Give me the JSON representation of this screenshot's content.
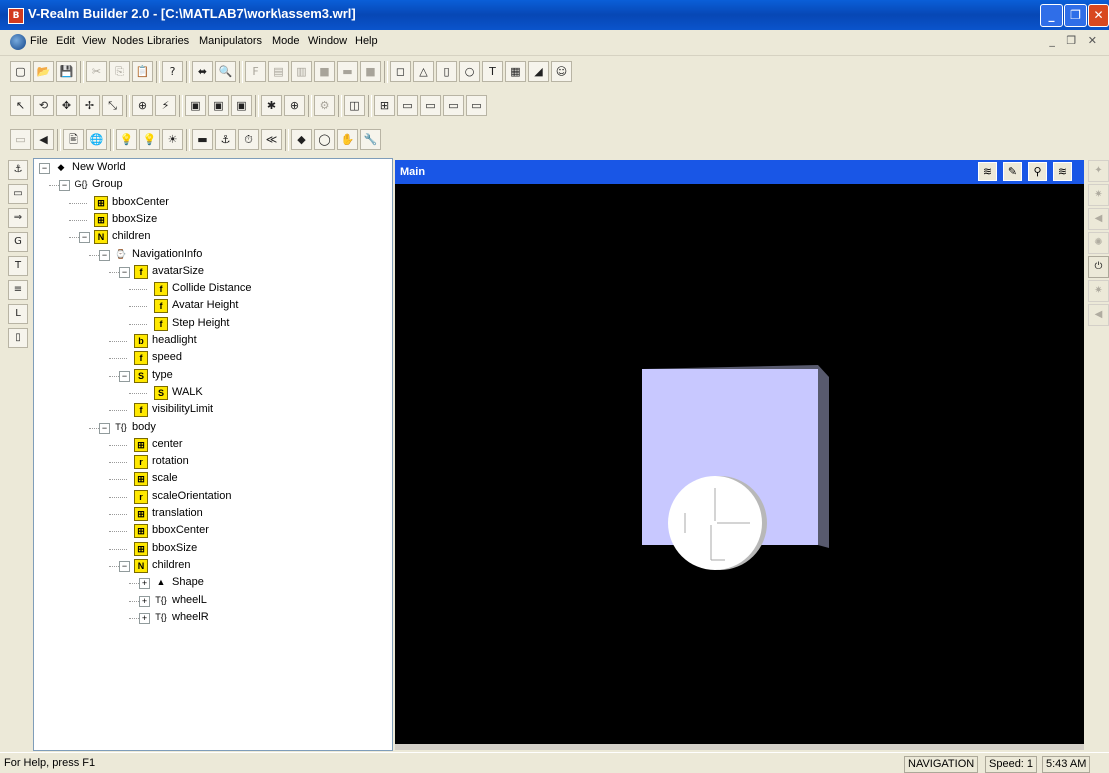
{
  "window": {
    "title": "V-Realm Builder 2.0 - [C:\\MATLAB7\\work\\assem3.wrl]",
    "app_icon_letter": "B",
    "minimize": "_",
    "restore": "❐",
    "close": "✕"
  },
  "menubar": {
    "items": [
      "File",
      "Edit",
      "View",
      "Nodes",
      "Libraries",
      "Manipulators",
      "Mode",
      "Window",
      "Help"
    ],
    "mdi_controls": "_ ❐ ✕"
  },
  "toolbars": {
    "row1": [
      {
        "glyph": "▢",
        "name": "new-icon",
        "enabled": true
      },
      {
        "glyph": "📂",
        "name": "open-icon",
        "enabled": true
      },
      {
        "glyph": "💾",
        "name": "save-icon",
        "enabled": true
      },
      {
        "glyph": "✂",
        "name": "cut-icon",
        "enabled": false
      },
      {
        "glyph": "⎘",
        "name": "copy-icon",
        "enabled": false
      },
      {
        "glyph": "📋",
        "name": "paste-icon",
        "enabled": false
      },
      {
        "glyph": "?",
        "name": "help-icon",
        "enabled": true
      },
      {
        "glyph": "⬌",
        "name": "link-icon",
        "enabled": true
      },
      {
        "glyph": "🔍",
        "name": "search-icon",
        "enabled": false
      },
      {
        "glyph": "F",
        "name": "function-icon",
        "enabled": false
      },
      {
        "glyph": "▤",
        "name": "script-icon",
        "enabled": false
      },
      {
        "glyph": "▥",
        "name": "grid-icon",
        "enabled": false
      },
      {
        "glyph": "■",
        "name": "block-icon",
        "enabled": false
      },
      {
        "glyph": "▬",
        "name": "bar-icon",
        "enabled": false
      },
      {
        "glyph": "■",
        "name": "square-icon",
        "enabled": false
      },
      {
        "glyph": "◻",
        "name": "box-icon",
        "enabled": true
      },
      {
        "glyph": "△",
        "name": "cone-icon",
        "enabled": true
      },
      {
        "glyph": "▯",
        "name": "cylinder-icon",
        "enabled": true
      },
      {
        "glyph": "○",
        "name": "sphere-icon",
        "enabled": true
      },
      {
        "glyph": "T",
        "name": "text-icon",
        "enabled": true
      },
      {
        "glyph": "▦",
        "name": "elevation-grid-icon",
        "enabled": true
      },
      {
        "glyph": "◢",
        "name": "extrusion-icon",
        "enabled": true
      },
      {
        "glyph": "☺",
        "name": "face-icon",
        "enabled": true
      }
    ],
    "row2": [
      {
        "glyph": "↖",
        "name": "select-arrow-icon",
        "enabled": true
      },
      {
        "glyph": "⟲",
        "name": "rotate-icon",
        "enabled": true
      },
      {
        "glyph": "✥",
        "name": "move-icon",
        "enabled": true
      },
      {
        "glyph": "✢",
        "name": "move-xy-icon",
        "enabled": true
      },
      {
        "glyph": "⤡",
        "name": "scale-icon",
        "enabled": true
      },
      {
        "glyph": "⊕",
        "name": "center-icon",
        "enabled": true
      },
      {
        "glyph": "⚡",
        "name": "route-icon",
        "enabled": true
      },
      {
        "glyph": "▣",
        "name": "view-front-icon",
        "enabled": true
      },
      {
        "glyph": "▣",
        "name": "view-side-icon",
        "enabled": true
      },
      {
        "glyph": "▣",
        "name": "view-top-icon",
        "enabled": true
      },
      {
        "glyph": "✱",
        "name": "navigation-mode-icon",
        "enabled": true
      },
      {
        "glyph": "⊕",
        "name": "examine-icon",
        "enabled": true
      },
      {
        "glyph": "⚙",
        "name": "settings-icon",
        "enabled": false
      },
      {
        "glyph": "◫",
        "name": "single-view-icon",
        "enabled": true
      },
      {
        "glyph": "⊞",
        "name": "quad-view-icon",
        "enabled": true
      },
      {
        "glyph": "▭",
        "name": "layout-1-icon",
        "enabled": true
      },
      {
        "glyph": "▭",
        "name": "layout-2-icon",
        "enabled": true
      },
      {
        "glyph": "▭",
        "name": "layout-3-icon",
        "enabled": true
      },
      {
        "glyph": "▭",
        "name": "layout-4-icon",
        "enabled": true
      }
    ],
    "row3": [
      {
        "glyph": "▭",
        "name": "input-icon",
        "enabled": false
      },
      {
        "glyph": "◀",
        "name": "sound-icon",
        "enabled": true
      },
      {
        "glyph": "🖹",
        "name": "document-icon",
        "enabled": true
      },
      {
        "glyph": "🌐",
        "name": "world-icon",
        "enabled": true
      },
      {
        "glyph": "💡",
        "name": "point-light-icon",
        "enabled": true
      },
      {
        "glyph": "💡",
        "name": "spot-light-icon",
        "enabled": true
      },
      {
        "glyph": "☀",
        "name": "directional-light-icon",
        "enabled": true
      },
      {
        "glyph": "▬",
        "name": "background-icon",
        "enabled": true
      },
      {
        "glyph": "⚓",
        "name": "anchor-icon",
        "enabled": true
      },
      {
        "glyph": "⏱",
        "name": "time-sensor-icon",
        "enabled": true
      },
      {
        "glyph": "≪",
        "name": "interpolator-icon",
        "enabled": true
      },
      {
        "glyph": "◆",
        "name": "proximity-sensor-icon",
        "enabled": true
      },
      {
        "glyph": "◯",
        "name": "touch-sensor-icon",
        "enabled": true
      },
      {
        "glyph": "✋",
        "name": "drag-sensor-icon",
        "enabled": true
      },
      {
        "glyph": "🔧",
        "name": "script-tool-icon",
        "enabled": true
      }
    ]
  },
  "left_tools": [
    {
      "glyph": "⚓",
      "name": "anchor-tool-icon"
    },
    {
      "glyph": "▭",
      "name": "billboard-tool-icon"
    },
    {
      "glyph": "⇒",
      "name": "inline-tool-icon"
    },
    {
      "glyph": "G",
      "name": "group-tool-icon"
    },
    {
      "glyph": "T",
      "name": "transform-tool-icon"
    },
    {
      "glyph": "≡",
      "name": "switch-tool-icon"
    },
    {
      "glyph": "L",
      "name": "lod-tool-icon"
    },
    {
      "glyph": "▯",
      "name": "collision-tool-icon"
    }
  ],
  "tree": [
    {
      "level": 0,
      "expander": "−",
      "icon": "◆",
      "label": "New World",
      "plain": true
    },
    {
      "level": 1,
      "expander": "−",
      "icon": "G{}",
      "label": "Group",
      "plain": true
    },
    {
      "level": 2,
      "expander": "",
      "icon": "⊞",
      "label": "bboxCenter"
    },
    {
      "level": 2,
      "expander": "",
      "icon": "⊞",
      "label": "bboxSize"
    },
    {
      "level": 2,
      "expander": "−",
      "icon": "N",
      "label": "children"
    },
    {
      "level": 3,
      "expander": "−",
      "icon": "⌚",
      "label": "NavigationInfo",
      "plain": true
    },
    {
      "level": 4,
      "expander": "−",
      "icon": "f",
      "label": "avatarSize"
    },
    {
      "level": 5,
      "expander": "",
      "icon": "f",
      "label": "Collide Distance"
    },
    {
      "level": 5,
      "expander": "",
      "icon": "f",
      "label": "Avatar Height"
    },
    {
      "level": 5,
      "expander": "",
      "icon": "f",
      "label": "Step Height"
    },
    {
      "level": 4,
      "expander": "",
      "icon": "b",
      "label": "headlight"
    },
    {
      "level": 4,
      "expander": "",
      "icon": "f",
      "label": "speed"
    },
    {
      "level": 4,
      "expander": "−",
      "icon": "S",
      "label": "type"
    },
    {
      "level": 5,
      "expander": "",
      "icon": "S",
      "label": "WALK"
    },
    {
      "level": 4,
      "expander": "",
      "icon": "f",
      "label": "visibilityLimit"
    },
    {
      "level": 3,
      "expander": "−",
      "icon": "T{}",
      "label": "body",
      "plain": true
    },
    {
      "level": 4,
      "expander": "",
      "icon": "⊞",
      "label": "center"
    },
    {
      "level": 4,
      "expander": "",
      "icon": "r",
      "label": "rotation"
    },
    {
      "level": 4,
      "expander": "",
      "icon": "⊞",
      "label": "scale"
    },
    {
      "level": 4,
      "expander": "",
      "icon": "r",
      "label": "scaleOrientation"
    },
    {
      "level": 4,
      "expander": "",
      "icon": "⊞",
      "label": "translation"
    },
    {
      "level": 4,
      "expander": "",
      "icon": "⊞",
      "label": "bboxCenter"
    },
    {
      "level": 4,
      "expander": "",
      "icon": "⊞",
      "label": "bboxSize"
    },
    {
      "level": 4,
      "expander": "−",
      "icon": "N",
      "label": "children"
    },
    {
      "level": 5,
      "expander": "+",
      "icon": "▲",
      "label": "Shape",
      "plain": true
    },
    {
      "level": 5,
      "expander": "+",
      "icon": "T{}",
      "label": "wheelL",
      "plain": true
    },
    {
      "level": 5,
      "expander": "+",
      "icon": "T{}",
      "label": "wheelR",
      "plain": true
    }
  ],
  "view": {
    "title": "Main",
    "buttons": [
      {
        "glyph": "≋",
        "name": "view-fly-icon"
      },
      {
        "glyph": "✎",
        "name": "view-pencil-icon"
      },
      {
        "glyph": "⚲",
        "name": "view-examine-icon"
      },
      {
        "glyph": "≋",
        "name": "view-walk-icon"
      }
    ],
    "colors": {
      "background": "#000000",
      "box_front": "#c8c8ff",
      "box_side": "#585a6e",
      "wheel": "#ffffff"
    }
  },
  "right_tools": [
    {
      "glyph": "✦",
      "name": "light-tool-1-icon",
      "on": false
    },
    {
      "glyph": "✷",
      "name": "light-tool-2-icon",
      "on": false
    },
    {
      "glyph": "◀",
      "name": "light-tool-3-icon",
      "on": false
    },
    {
      "glyph": "✺",
      "name": "light-tool-4-icon",
      "on": false
    },
    {
      "glyph": "⏻",
      "name": "headlight-toggle-icon",
      "on": true
    },
    {
      "glyph": "✷",
      "name": "light-tool-5-icon",
      "on": false
    },
    {
      "glyph": "◀",
      "name": "light-tool-6-icon",
      "on": false
    }
  ],
  "statusbar": {
    "help": "For Help, press F1",
    "mode": "NAVIGATION",
    "speed": "Speed: 1",
    "time": "5:43 AM"
  }
}
